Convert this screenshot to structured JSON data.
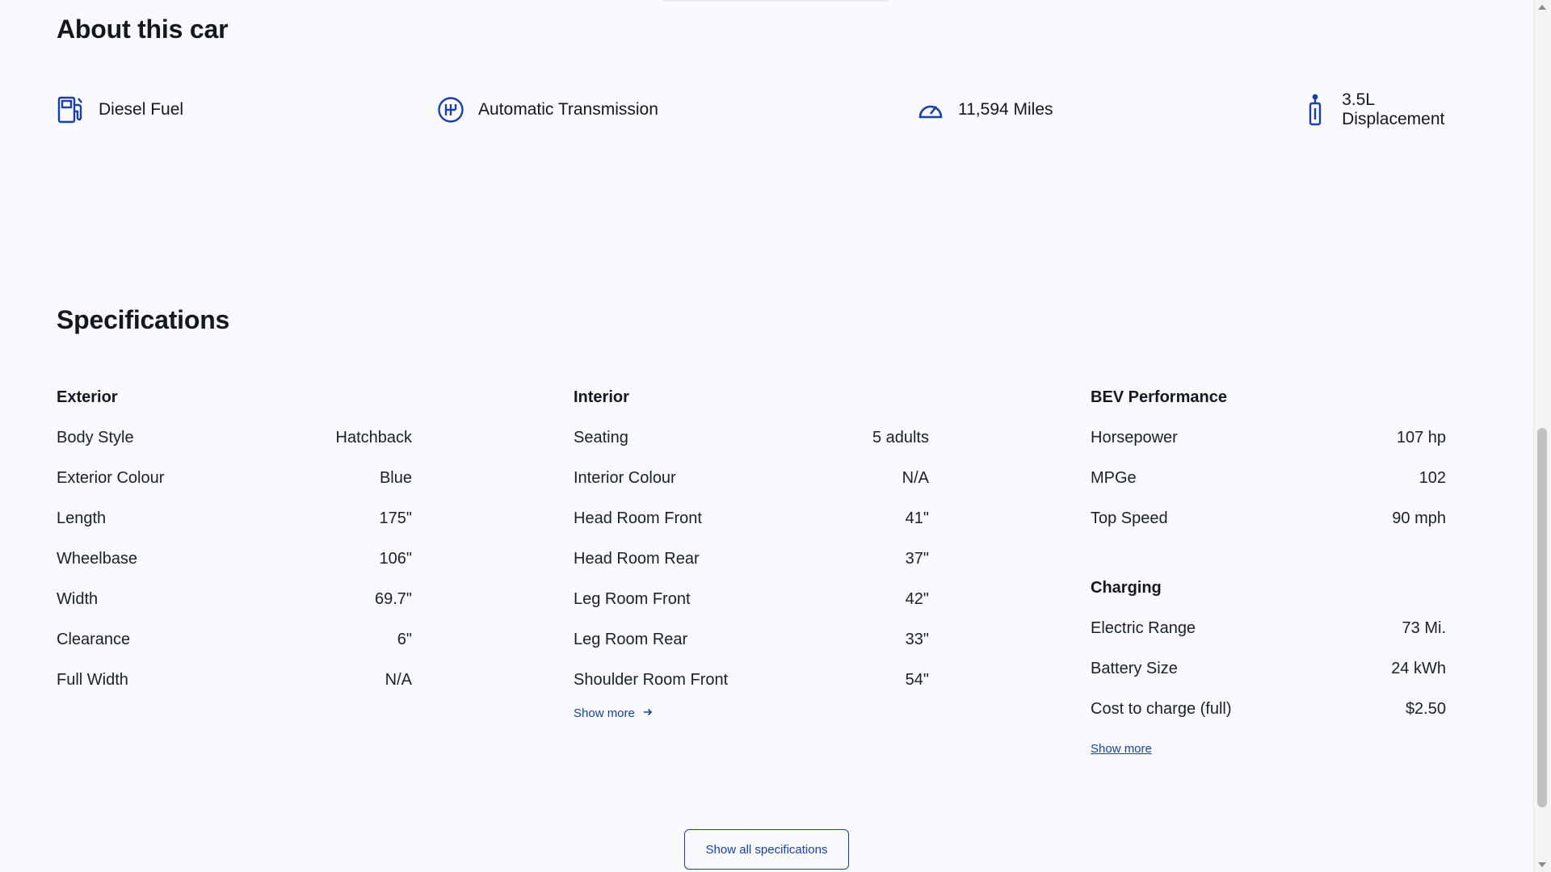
{
  "about": {
    "title": "About this car",
    "features": [
      {
        "icon": "fuel-pump-icon",
        "label": "Diesel Fuel"
      },
      {
        "icon": "gear-shift-icon",
        "label": "Automatic Transmission"
      },
      {
        "icon": "speedometer-icon",
        "label": "11,594 Miles"
      },
      {
        "icon": "piston-icon",
        "label": "3.5L Displacement"
      }
    ]
  },
  "specifications": {
    "title": "Specifications",
    "exterior": {
      "title": "Exterior",
      "rows": [
        {
          "label": "Body Style",
          "value": "Hatchback"
        },
        {
          "label": "Exterior Colour",
          "value": "Blue"
        },
        {
          "label": "Length",
          "value": "175\""
        },
        {
          "label": "Wheelbase",
          "value": "106\""
        },
        {
          "label": "Width",
          "value": "69.7\""
        },
        {
          "label": "Clearance",
          "value": "6\""
        },
        {
          "label": "Full Width",
          "value": "N/A"
        }
      ]
    },
    "interior": {
      "title": "Interior",
      "rows": [
        {
          "label": "Seating",
          "value": "5 adults"
        },
        {
          "label": "Interior Colour",
          "value": "N/A"
        },
        {
          "label": "Head Room Front",
          "value": "41\""
        },
        {
          "label": "Head Room Rear",
          "value": "37\""
        },
        {
          "label": "Leg Room Front",
          "value": "42\""
        },
        {
          "label": "Leg Room Rear",
          "value": "33\""
        },
        {
          "label": "Shoulder Room Front",
          "value": "54\""
        }
      ],
      "show_more": "Show more"
    },
    "bev_performance": {
      "title": "BEV Performance",
      "rows": [
        {
          "label": "Horsepower",
          "value": "107 hp"
        },
        {
          "label": "MPGe",
          "value": "102"
        },
        {
          "label": "Top Speed",
          "value": "90 mph"
        }
      ]
    },
    "charging": {
      "title": "Charging",
      "rows": [
        {
          "label": "Electric Range",
          "value": "73 Mi."
        },
        {
          "label": "Battery Size",
          "value": "24 kWh"
        },
        {
          "label": "Cost to charge (full)",
          "value": "$2.50"
        }
      ],
      "show_more": "Show more"
    },
    "show_all": "Show all specifications"
  },
  "colors": {
    "accent": "#1a3fa8",
    "background": "#f8fafd",
    "text": "#14171f"
  }
}
